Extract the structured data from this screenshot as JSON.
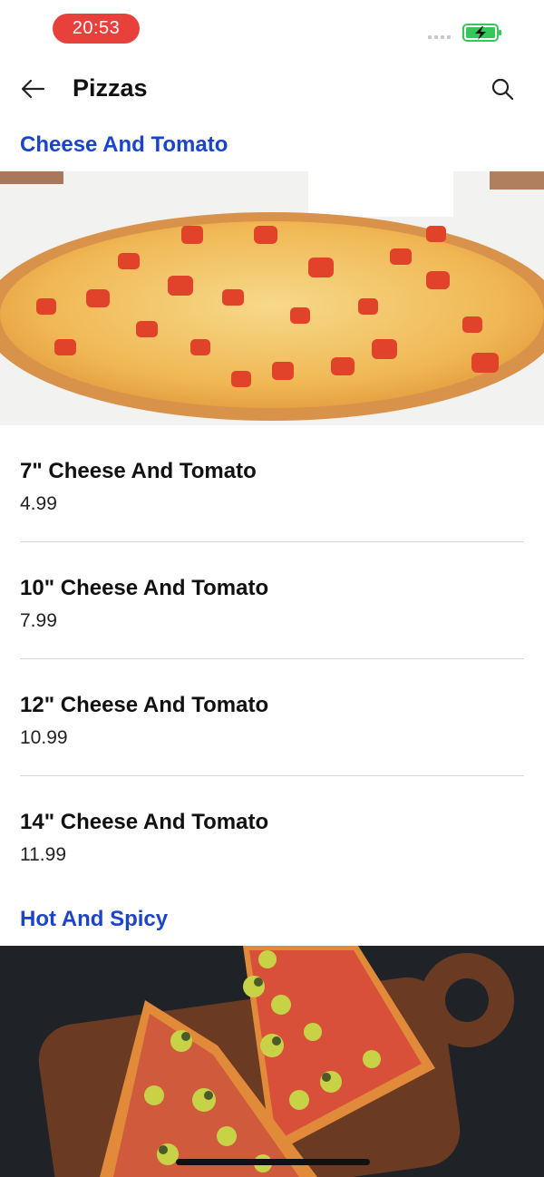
{
  "status_bar": {
    "time": "20:53",
    "time_pill_color": "#e8403a",
    "battery_icon": "battery-charging-icon",
    "battery_color": "#34c759"
  },
  "header": {
    "title": "Pizzas",
    "back_icon": "arrow-left-icon",
    "search_icon": "search-icon"
  },
  "accent_color": "#1a44c9",
  "sections": [
    {
      "title": "Cheese And Tomato",
      "image": "cheese-and-tomato-pizza-photo",
      "items": [
        {
          "name": "7\" Cheese And Tomato",
          "price": "4.99"
        },
        {
          "name": "10\" Cheese And Tomato",
          "price": "7.99"
        },
        {
          "name": "12\" Cheese And Tomato",
          "price": "10.99"
        },
        {
          "name": "14\" Cheese And Tomato",
          "price": "11.99"
        }
      ]
    },
    {
      "title": "Hot And Spicy",
      "image": "hot-and-spicy-pizza-photo"
    }
  ]
}
